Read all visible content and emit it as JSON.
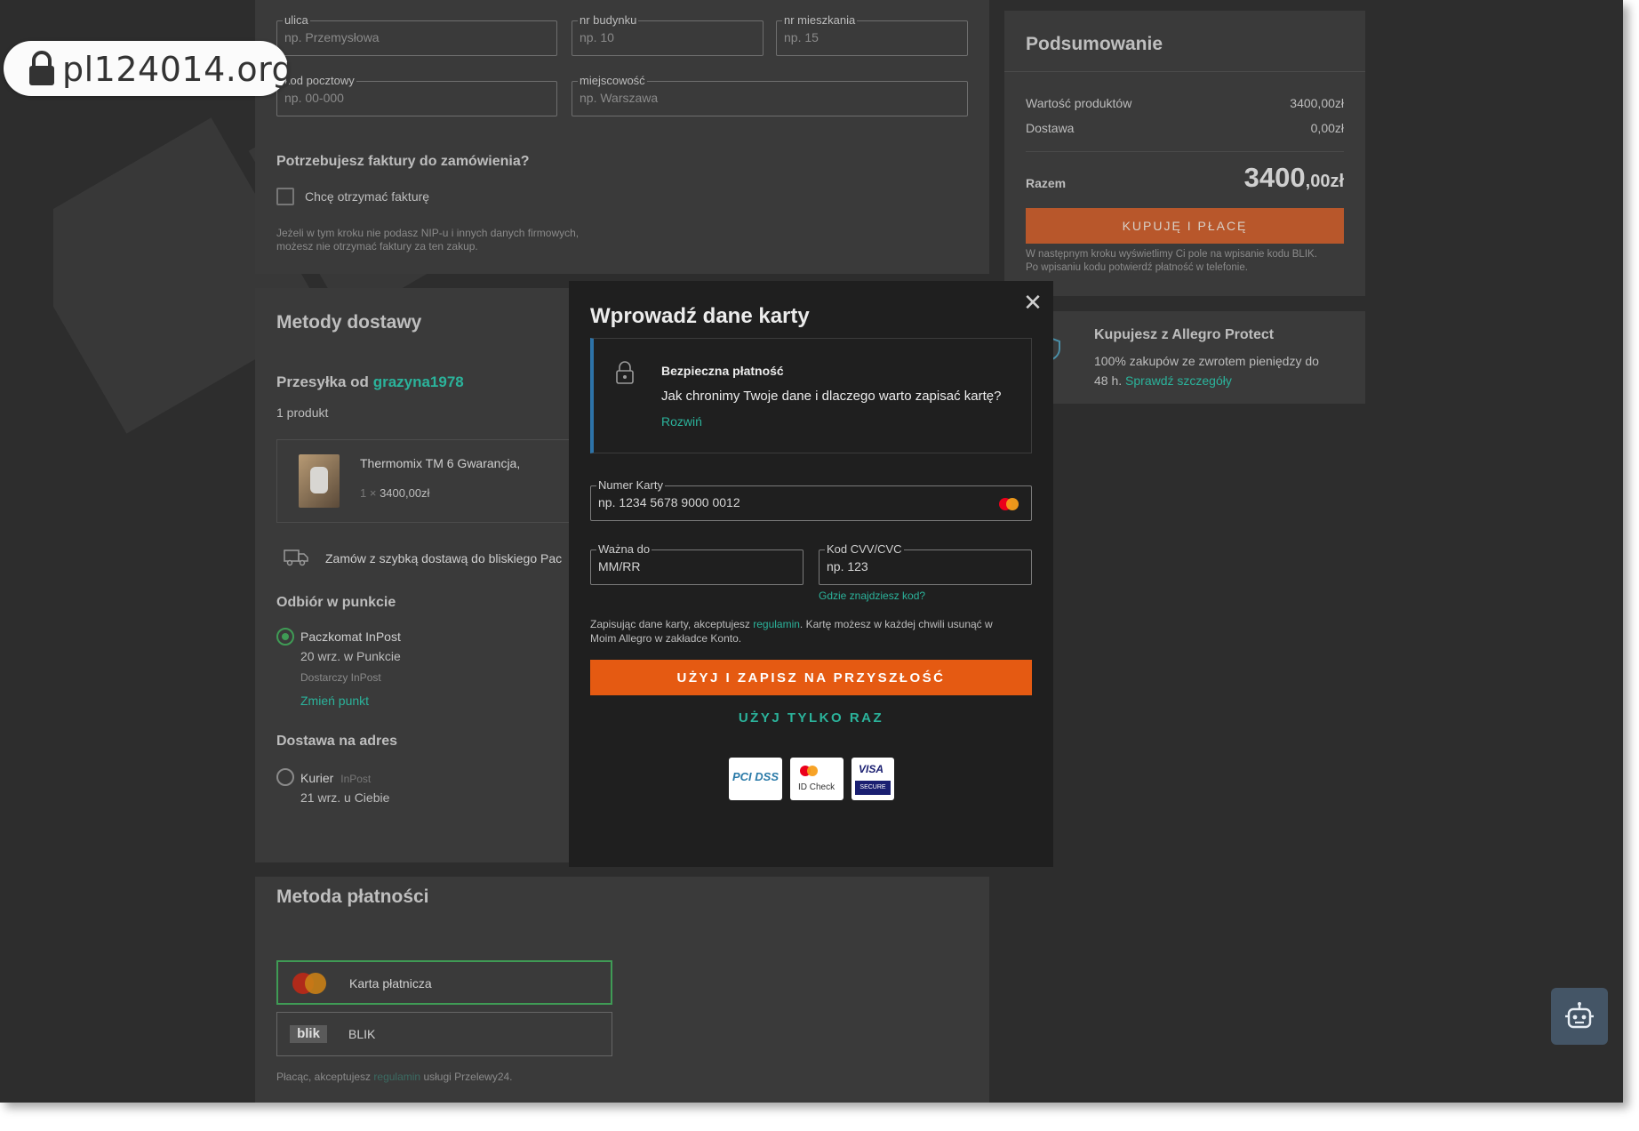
{
  "browser": {
    "address_domain": "pl124014.org"
  },
  "address": {
    "street": {
      "label": "ulica",
      "placeholder": "np. Przemysłowa"
    },
    "building": {
      "label": "nr budynku",
      "placeholder": "np. 10"
    },
    "apartment": {
      "label": "nr mieszkania",
      "placeholder": "np. 15"
    },
    "postal": {
      "label": "kod pocztowy",
      "placeholder": "np. 00-000"
    },
    "city": {
      "label": "miejscowość",
      "placeholder": "np. Warszawa"
    }
  },
  "invoice": {
    "question": "Potrzebujesz faktury do zamówienia?",
    "checkbox_label": "Chcę otrzymać fakturę",
    "note_line1": "Jeżeli w tym kroku nie podasz NIP-u i innych danych firmowych,",
    "note_line2": "możesz nie otrzymać faktury za ten zakup."
  },
  "delivery": {
    "title": "Metody dostawy",
    "shipment_prefix": "Przesyłka od",
    "seller": "grazyna1978",
    "product_count": "1 produkt",
    "product_name": "Thermomix TM 6 Gwarancja,",
    "product_qty": "1 ×",
    "product_price": "3400,00zł",
    "fast_delivery": "Zamów z szybką dostawą do bliskiego Pac",
    "pickup_header": "Odbiór w punkcie",
    "pickup_name": "Paczkomat InPost",
    "pickup_date": "20 wrz. w Punkcie",
    "pickup_carrier": "Dostarczy InPost",
    "pickup_change": "Zmień punkt",
    "address_header": "Dostawa na adres",
    "courier_name": "Kurier",
    "courier_brand": "InPost",
    "courier_date": "21 wrz. u Ciebie"
  },
  "payment": {
    "title": "Metoda płatności",
    "card_label": "Karta płatnicza",
    "blik_label": "BLIK",
    "blik_logo": "blik",
    "terms_prefix": "Płacąc, akceptujesz",
    "terms_link": "regulamin",
    "terms_suffix": "usługi Przelewy24."
  },
  "summary": {
    "title": "Podsumowanie",
    "products_label": "Wartość produktów",
    "products_value": "3400,00zł",
    "shipping_label": "Dostawa",
    "shipping_value": "0,00zł",
    "total_label": "Razem",
    "total_main": "3400",
    "total_fraction": ",00zł",
    "buy_button": "KUPUJĘ I PŁACĘ",
    "blik_note_line1": "W następnym kroku wyświetlimy Ci pole na wpisanie kodu BLIK.",
    "blik_note_line2": "Po wpisaniu kodu potwierdź płatność w telefonie."
  },
  "protect": {
    "title": "Kupujesz z Allegro Protect",
    "text_line1": "100% zakupów ze zwrotem pieniędzy do",
    "text_line2_prefix": "48 h.",
    "link": "Sprawdź szczegóły"
  },
  "modal": {
    "title": "Wprowadź dane karty",
    "secure_title": "Bezpieczna płatność",
    "secure_text": "Jak chronimy Twoje dane i dlaczego warto zapisać kartę?",
    "secure_expand": "Rozwiń",
    "card_number_label": "Numer Karty",
    "card_number_placeholder": "np. 1234 5678 9000 0012",
    "expiry_label": "Ważna do",
    "expiry_placeholder": "MM/RR",
    "cvv_label": "Kod CVV/CVC",
    "cvv_placeholder": "np. 123",
    "cvv_help": "Gdzie znajdziesz kod?",
    "terms_prefix": "Zapisując dane karty, akceptujesz",
    "terms_link": "regulamin",
    "terms_suffix": ". Kartę możesz w każdej chwili usunąć w",
    "terms_line2": "Moim Allegro w zakładce Konto.",
    "save_button": "UŻYJ I ZAPISZ NA PRZYSZŁOŚĆ",
    "once_button": "UŻYJ TYLKO RAZ",
    "badge_pci": "PCI DSS",
    "badge_idcheck": "ID Check",
    "badge_visa": "VISA",
    "badge_visa_sub": "SECURE"
  },
  "icons": [
    "lock-icon",
    "close-icon",
    "padlock-icon",
    "mastercard-icon",
    "truck-icon",
    "shield-icon",
    "bot-icon"
  ],
  "colors": {
    "accent_green": "#2bb39b",
    "cta_orange": "#e55a12",
    "selected_green": "#3f9b55"
  }
}
